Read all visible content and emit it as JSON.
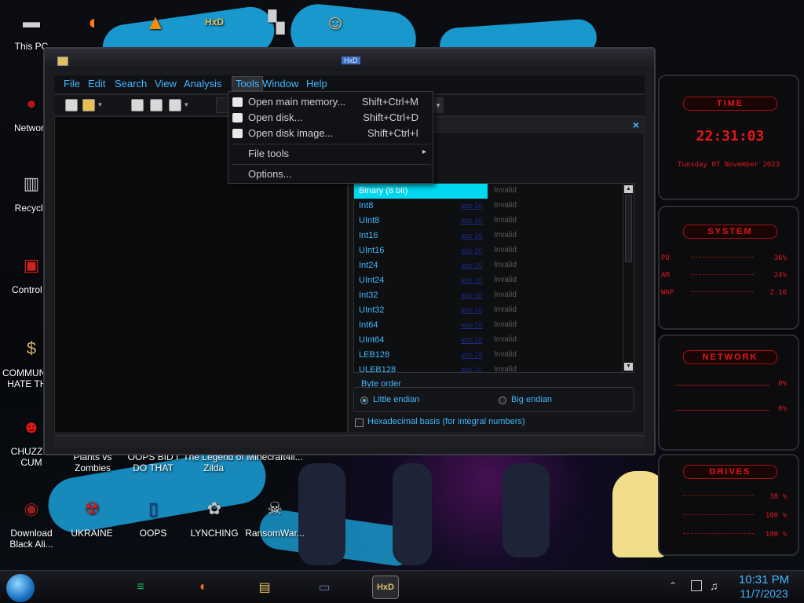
{
  "desktop": {
    "icons_left": [
      {
        "label": "This PC",
        "glyph": "▬",
        "color": "#d0d0d0"
      },
      {
        "label": "Network",
        "glyph": "●",
        "color": "#b01818"
      },
      {
        "label": "Recycle",
        "glyph": "▥",
        "color": "#c0c0c0"
      },
      {
        "label": "Control P",
        "glyph": "▣",
        "color": "#d02020"
      },
      {
        "label": "COMMUNIST HATE THIS",
        "glyph": "$",
        "color": "#d7b070"
      },
      {
        "label": "CHUZZIN CUM",
        "glyph": "☻",
        "color": "#e01818"
      },
      {
        "label": "Download Black Ali...",
        "glyph": "◉",
        "color": "#902020"
      }
    ],
    "icons_top": [
      {
        "label": "",
        "glyph": "◐",
        "color": "#ff7a1a"
      },
      {
        "label": "",
        "glyph": "▲",
        "color": "#ff8a00"
      },
      {
        "label": "",
        "glyph": "HxD",
        "color": "#e0c060"
      },
      {
        "label": "",
        "glyph": "▚",
        "color": "#d0d0d0"
      },
      {
        "label": "",
        "glyph": "☺",
        "color": "#f0c080"
      }
    ],
    "icons_row": [
      {
        "label": "Plants vs Zombies"
      },
      {
        "label": "OOPS BID I DO THAT"
      },
      {
        "label": "The Legend of Zilda"
      },
      {
        "label": "Minecraft4il..."
      }
    ],
    "icons_bottom": [
      {
        "label": "UKRAINE",
        "glyph": "☢",
        "color": "#d02020"
      },
      {
        "label": "OOPS",
        "glyph": "▯",
        "color": "#1a3a8a"
      },
      {
        "label": "LYNCHING",
        "glyph": "✿",
        "color": "#c0c0c0"
      },
      {
        "label": "RansomWar...",
        "glyph": "☠",
        "color": "#e0e0e0"
      }
    ]
  },
  "widgets": {
    "time": {
      "title": "TIME",
      "clock": "22:31:03",
      "date": "Tuesday 07 November 2023"
    },
    "system": {
      "title": "SYSTEM",
      "rows": [
        {
          "label": "PU",
          "value": "36%"
        },
        {
          "label": "AM",
          "value": "24%"
        },
        {
          "label": "WAP",
          "value": "2.16"
        }
      ]
    },
    "network": {
      "title": "NETWORK",
      "rows": [
        {
          "value": "0%"
        },
        {
          "value": "0%"
        }
      ]
    },
    "drives": {
      "title": "DRIVES",
      "rows": [
        {
          "value": "38 %"
        },
        {
          "value": "100 %"
        },
        {
          "value": "100 %"
        }
      ]
    }
  },
  "window": {
    "title": "HxD",
    "menus": [
      "File",
      "Edit",
      "Search",
      "View",
      "Analysis",
      "Tools",
      "Window",
      "Help"
    ],
    "active_menu": "Tools",
    "close_glyph": "×",
    "tools_menu": [
      {
        "label": "Open main memory...",
        "shortcut": "Shift+Ctrl+M"
      },
      {
        "label": "Open disk...",
        "shortcut": "Shift+Ctrl+D"
      },
      {
        "label": "Open disk image...",
        "shortcut": "Shift+Ctrl+I"
      },
      {
        "label": "File tools",
        "shortcut": "▸"
      },
      {
        "label": "Options...",
        "shortcut": ""
      }
    ],
    "datatypes": [
      {
        "name": "Binary (8 bit)",
        "value": "",
        "status": "Invalid",
        "selected": true
      },
      {
        "name": "Int8",
        "value": "abc-10",
        "status": "Invalid"
      },
      {
        "name": "UInt8",
        "value": "abc-10",
        "status": "Invalid"
      },
      {
        "name": "Int16",
        "value": "abc-10",
        "status": "Invalid"
      },
      {
        "name": "UInt16",
        "value": "abc-10",
        "status": "Invalid"
      },
      {
        "name": "Int24",
        "value": "abc-10",
        "status": "Invalid"
      },
      {
        "name": "UInt24",
        "value": "abc-10",
        "status": "Invalid"
      },
      {
        "name": "Int32",
        "value": "abc-10",
        "status": "Invalid"
      },
      {
        "name": "UInt32",
        "value": "abc-10",
        "status": "Invalid"
      },
      {
        "name": "Int64",
        "value": "abc-10",
        "status": "Invalid"
      },
      {
        "name": "UInt64",
        "value": "abc-10",
        "status": "Invalid"
      },
      {
        "name": "LEB128",
        "value": "abc-10",
        "status": "Invalid"
      },
      {
        "name": "ULEB128",
        "value": "abc-10",
        "status": "Invalid"
      }
    ],
    "byte_order": {
      "title": "Byte order",
      "little": "Little endian",
      "big": "Big endian",
      "selected": "little"
    },
    "hex_basis": "Hexadecimal basis (for integral numbers)"
  },
  "taskbar": {
    "apps": [
      {
        "name": "spotify",
        "glyph": "≡",
        "color": "#1db954"
      },
      {
        "name": "firefox",
        "glyph": "◐",
        "color": "#ff7a1a"
      },
      {
        "name": "explorer",
        "glyph": "▤",
        "color": "#e8c060"
      },
      {
        "name": "remote",
        "glyph": "▭",
        "color": "#6a7ab8"
      },
      {
        "name": "hxd",
        "glyph": "HxD",
        "color": "#e0c060"
      }
    ],
    "time": "10:31 PM",
    "date": "11/7/2023"
  }
}
